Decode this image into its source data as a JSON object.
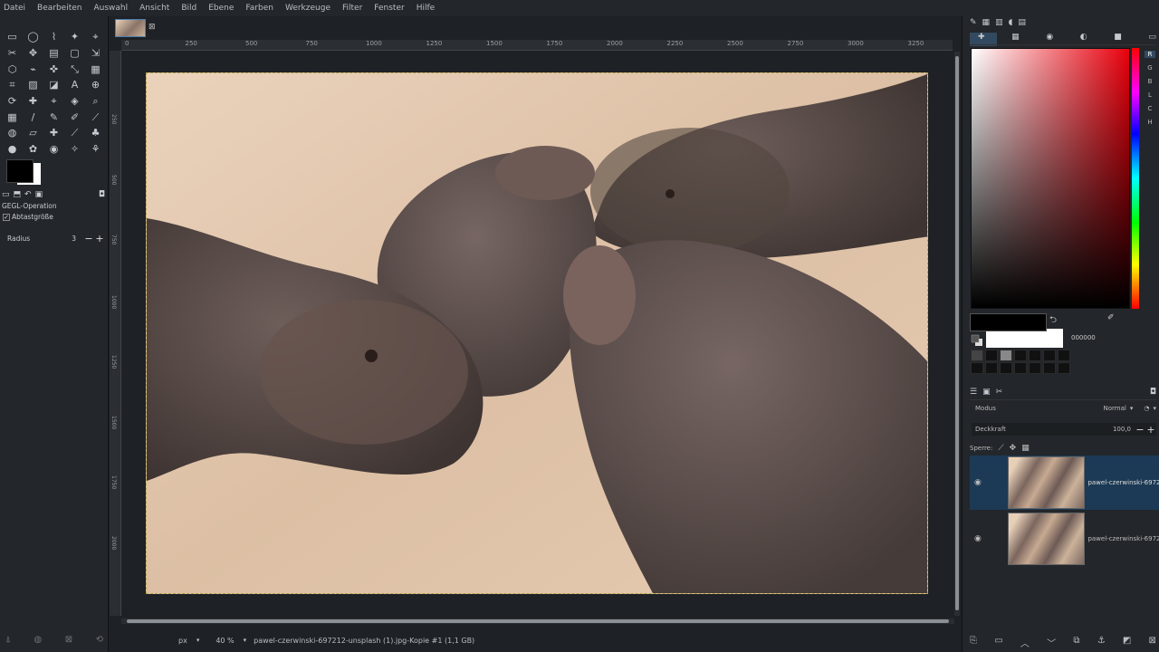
{
  "menu": [
    "Datei",
    "Bearbeiten",
    "Auswahl",
    "Ansicht",
    "Bild",
    "Ebene",
    "Farben",
    "Werkzeuge",
    "Filter",
    "Fenster",
    "Hilfe"
  ],
  "toolbox": {
    "tools": [
      "▭",
      "◯",
      "⌇",
      "✦",
      "⌖",
      "✂",
      "✥",
      "▤",
      "▢",
      "⇲",
      "⬡",
      "⌁",
      "✜",
      "⤡",
      "▦",
      "⌗",
      "▨",
      "◪",
      "A",
      "⊕",
      "⟳",
      "✚",
      "⌖",
      "◈",
      "⌕",
      "▦",
      "/",
      "✎",
      "✐",
      "⟋",
      "◍",
      "▱",
      "✚",
      "⟋",
      "♣",
      "●",
      "✿",
      "◉",
      "✧",
      "⚘"
    ],
    "tool_options_title": "GEGL-Operation",
    "sample_merged_label": "Abtastgröße",
    "radius_label": "Radius",
    "radius_value": "3"
  },
  "image_tab": {
    "close_glyph": "⊠"
  },
  "ruler_h": [
    "0",
    "250",
    "500",
    "750",
    "1000",
    "1250",
    "1500",
    "1750",
    "2000",
    "2250",
    "2500",
    "2750",
    "3000",
    "3250"
  ],
  "ruler_v": [
    "250",
    "500",
    "750",
    "1000",
    "1250",
    "1500",
    "1750",
    "2000"
  ],
  "status": {
    "unit": "px",
    "zoom": "40 %",
    "title": "pawel-czerwinski-697212-unsplash (1).jpg-Kopie #1 (1,1 GB)"
  },
  "colors": {
    "channels": [
      "R",
      "G",
      "B",
      "L",
      "C",
      "H"
    ],
    "hex": "000000",
    "accent": "#33495f"
  },
  "layers": {
    "mode_label": "Modus",
    "mode_value": "Normal",
    "opacity_label": "Deckkraft",
    "opacity_value": "100,0",
    "lock_label": "Sperre:",
    "items": [
      {
        "name": "pawel-czerwinski-6972"
      },
      {
        "name": "pawel-czerwinski-6972"
      }
    ]
  }
}
